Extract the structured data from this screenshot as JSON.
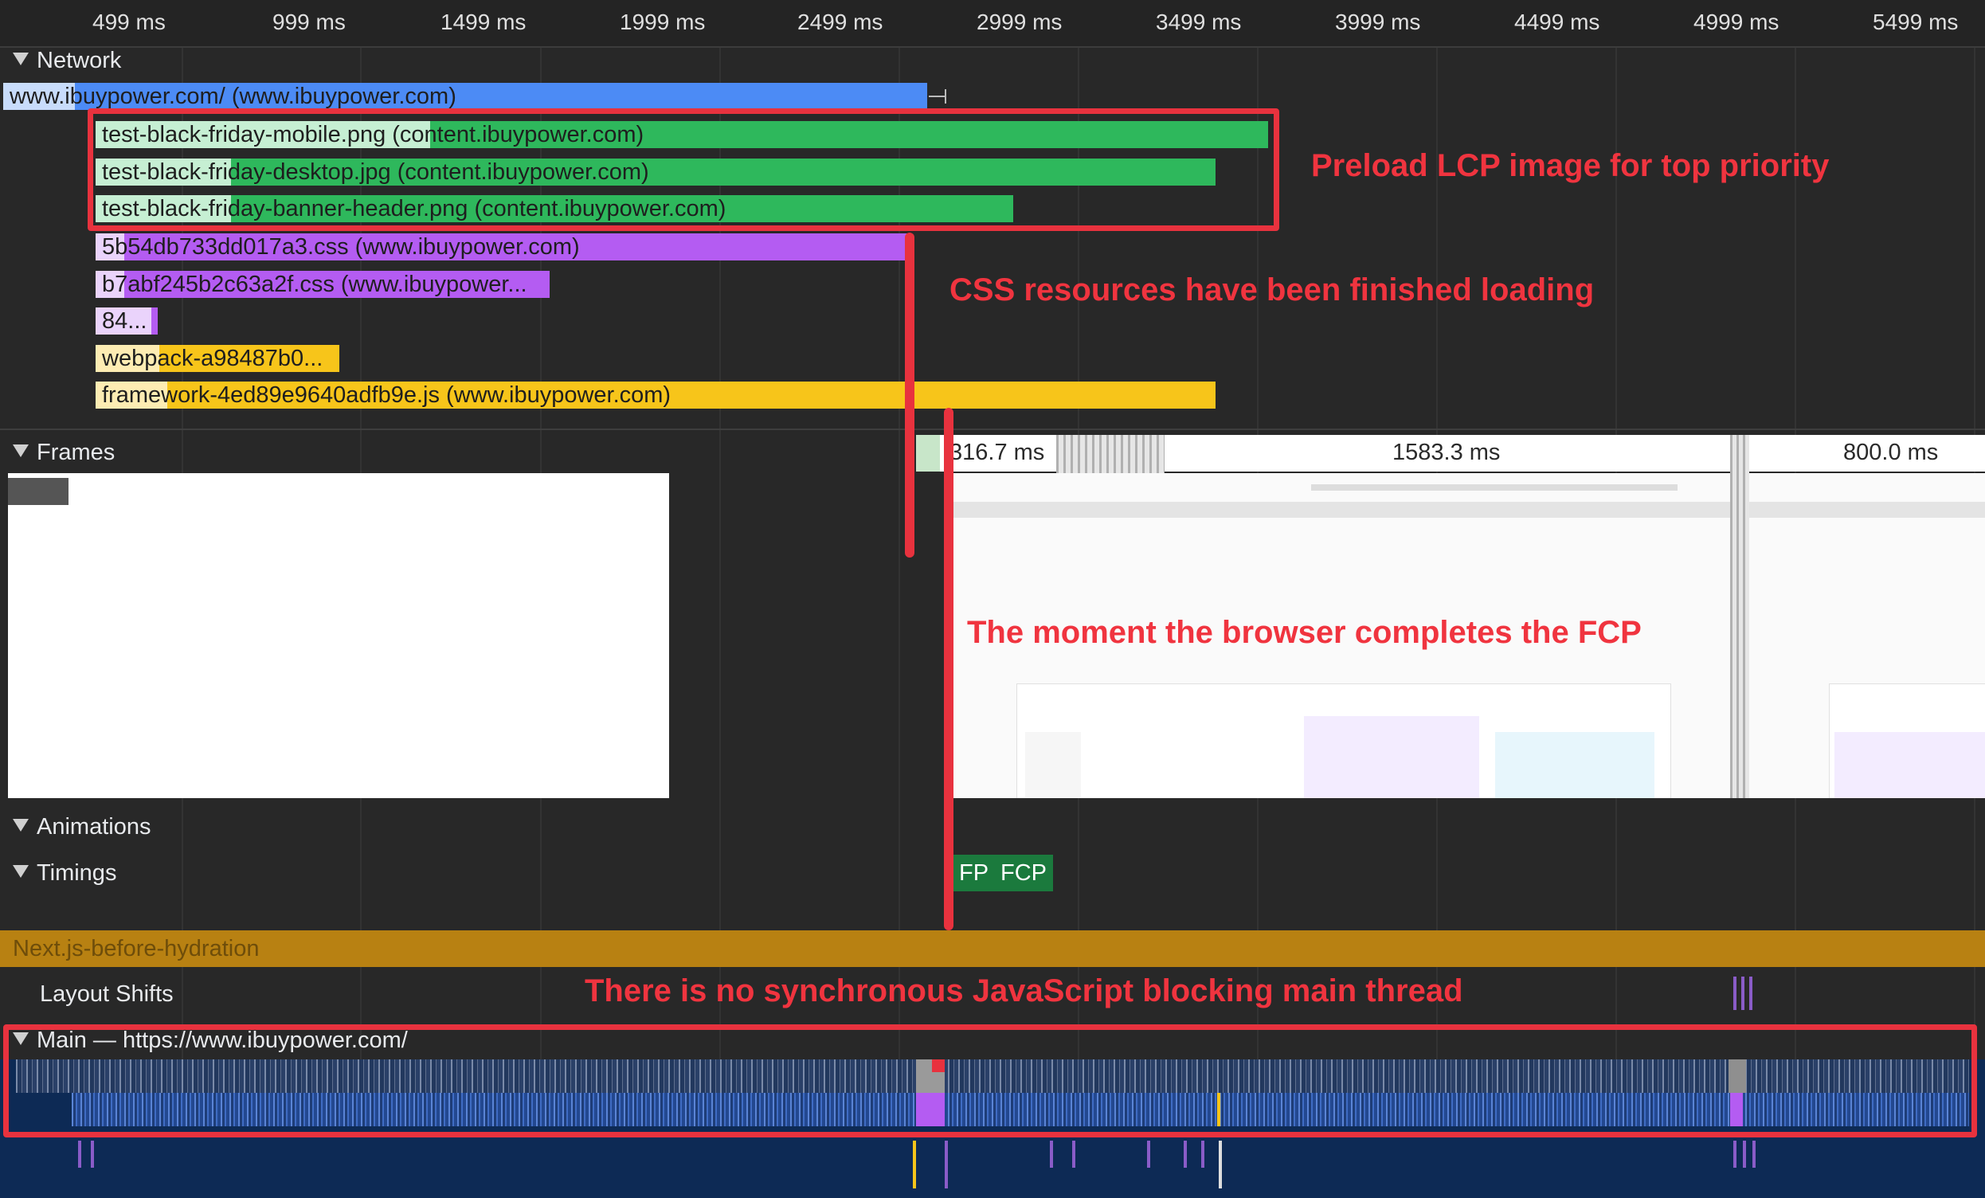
{
  "ruler": {
    "ticks": [
      "499 ms",
      "999 ms",
      "1499 ms",
      "1999 ms",
      "2499 ms",
      "2999 ms",
      "3499 ms",
      "3999 ms",
      "4499 ms",
      "4999 ms",
      "5499 ms"
    ]
  },
  "tracks": {
    "network": "Network",
    "frames": "Frames",
    "animations": "Animations",
    "timings": "Timings",
    "nextjs": "Next.js-before-hydration",
    "layout_shifts": "Layout Shifts",
    "main": "Main — https://www.ibuypower.com/"
  },
  "network_requests": [
    {
      "label": "www.ibuypower.com/ (www.ibuypower.com)",
      "type": "document"
    },
    {
      "label": "test-black-friday-mobile.png (content.ibuypower.com)",
      "type": "image"
    },
    {
      "label": "test-black-friday-desktop.jpg (content.ibuypower.com)",
      "type": "image"
    },
    {
      "label": "test-black-friday-banner-header.png (content.ibuypower.com)",
      "type": "image"
    },
    {
      "label": "5b54db733dd017a3.css (www.ibuypower.com)",
      "type": "css"
    },
    {
      "label": "b7abf245b2c63a2f.css (www.ibuypower...",
      "type": "css"
    },
    {
      "label": "84...",
      "type": "css"
    },
    {
      "label": "webpack-a98487b0...",
      "type": "script"
    },
    {
      "label": "framework-4ed89e9640adfb9e.js (www.ibuypower.com)",
      "type": "script"
    }
  ],
  "frames": {
    "durations": [
      "316.7 ms",
      "1583.3 ms",
      "800.0 ms"
    ]
  },
  "timings": {
    "fp": "FP",
    "fcp": "FCP"
  },
  "annotations": {
    "preload": "Preload LCP image for top priority",
    "css_done": "CSS resources have been finished loading",
    "fcp_moment": "The moment the browser completes the FCP",
    "no_sync_js": "There is no synchronous JavaScript blocking main thread"
  },
  "colors": {
    "document": "#4c8bf5",
    "image": "#2eb85c",
    "css": "#b45cf2",
    "script": "#f7c51a",
    "annotation": "#e8323e"
  }
}
